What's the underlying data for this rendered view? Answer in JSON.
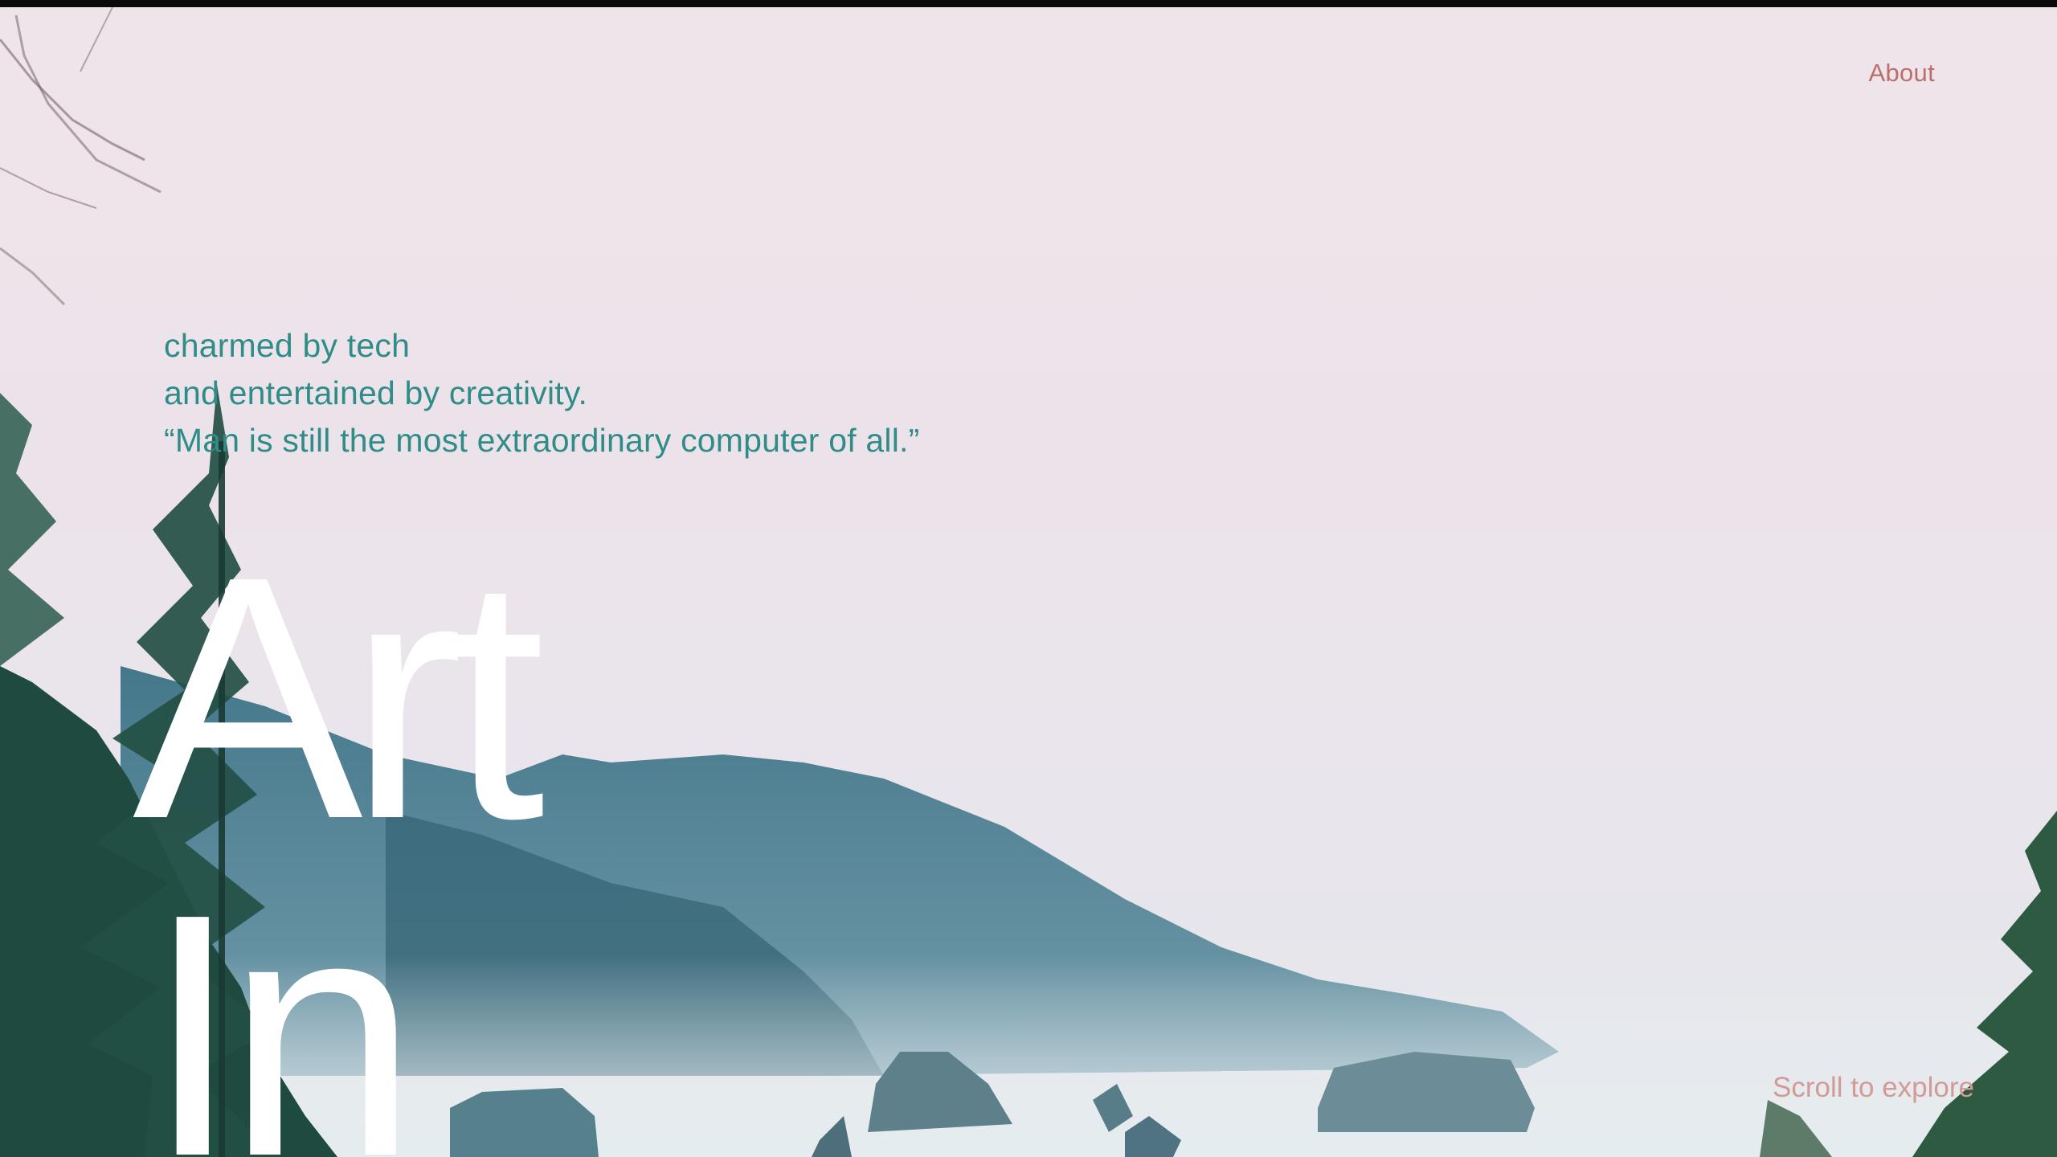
{
  "nav": {
    "about_label": "About"
  },
  "hero": {
    "tagline_lines": [
      "charmed by tech",
      "and entertained by creativity.",
      "“Man is still the most extraordinary computer of all.”"
    ],
    "headline_words": [
      "Art",
      "In"
    ],
    "scroll_hint": "Scroll to explore"
  },
  "colors": {
    "tagline": "#2f8c88",
    "nav_link": "#b96f6c",
    "scroll_hint": "#d39a96",
    "headline": "#ffffff",
    "sky": "#efe4ea"
  }
}
